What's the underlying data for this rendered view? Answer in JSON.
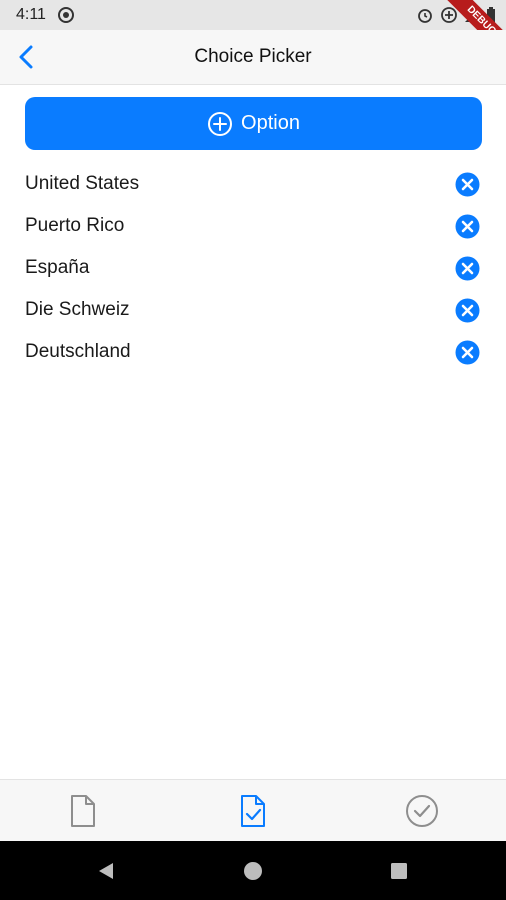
{
  "status_bar": {
    "time": "4:11",
    "debug_label": "DEBUG"
  },
  "nav": {
    "title": "Choice Picker"
  },
  "add_button": {
    "label": "Option"
  },
  "options": [
    {
      "label": "United States"
    },
    {
      "label": "Puerto Rico"
    },
    {
      "label": "España"
    },
    {
      "label": "Die Schweiz"
    },
    {
      "label": "Deutschland"
    }
  ],
  "tabs": [
    {
      "icon": "document-icon",
      "active": false
    },
    {
      "icon": "document-check-icon",
      "active": true
    },
    {
      "icon": "checkmark-circle-icon",
      "active": false
    }
  ],
  "colors": {
    "accent": "#0a7cff",
    "inactive_icon": "#8e8e8e"
  }
}
